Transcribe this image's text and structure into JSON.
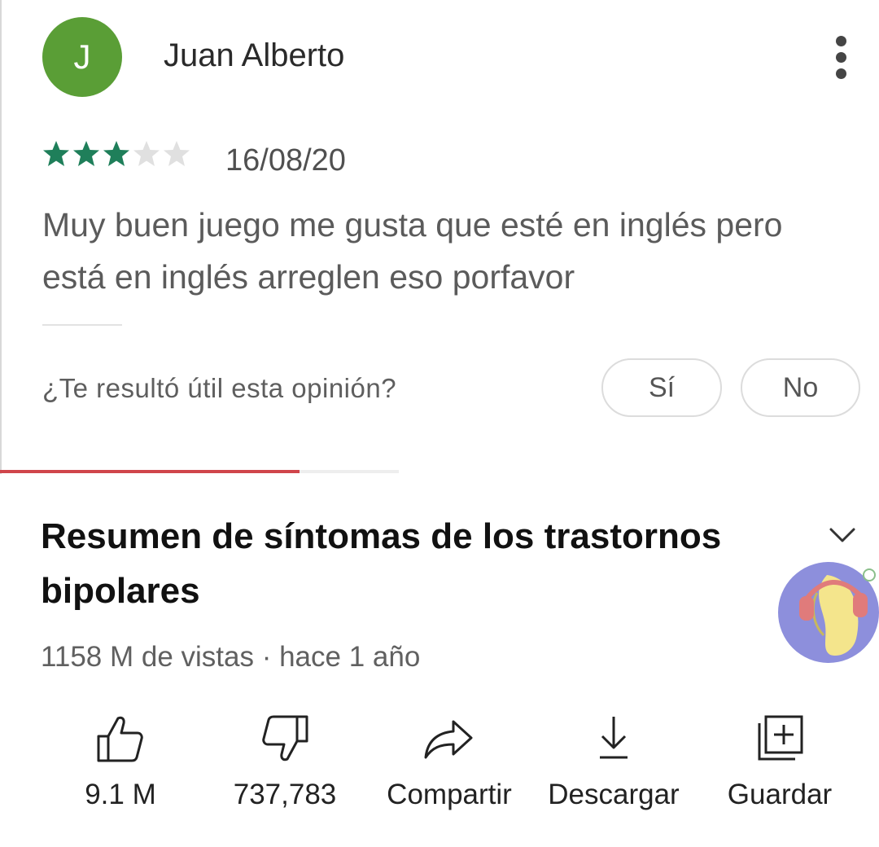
{
  "review": {
    "avatar_initial": "J",
    "avatar_color": "#5a9e36",
    "author": "Juan Alberto",
    "menu_icon": "more-vertical-icon",
    "rating": 3,
    "rating_max": 5,
    "star_color_filled": "#1f7f5a",
    "star_color_empty": "#e0e0e0",
    "date": "16/08/20",
    "text": "Muy buen juego me gusta que esté en inglés pero está en inglés arreglen eso porfavor",
    "helpful_question": "¿Te resultó útil esta opinión?",
    "yes_label": "Sí",
    "no_label": "No"
  },
  "video": {
    "progress_fraction": 0.75,
    "progress_color": "#d0454b",
    "title": "Resumen de síntomas de los trastornos bipolares",
    "expand_icon": "chevron-down-icon",
    "meta": "1158 M de vistas · hace 1 año",
    "channel_badge_icon": "banana-headphones-logo",
    "actions": [
      {
        "icon": "thumbs-up-icon",
        "label": "9.1 M"
      },
      {
        "icon": "thumbs-down-icon",
        "label": "737,783"
      },
      {
        "icon": "share-icon",
        "label": "Compartir"
      },
      {
        "icon": "download-icon",
        "label": "Descargar"
      },
      {
        "icon": "save-playlist-icon",
        "label": "Guardar"
      }
    ]
  }
}
